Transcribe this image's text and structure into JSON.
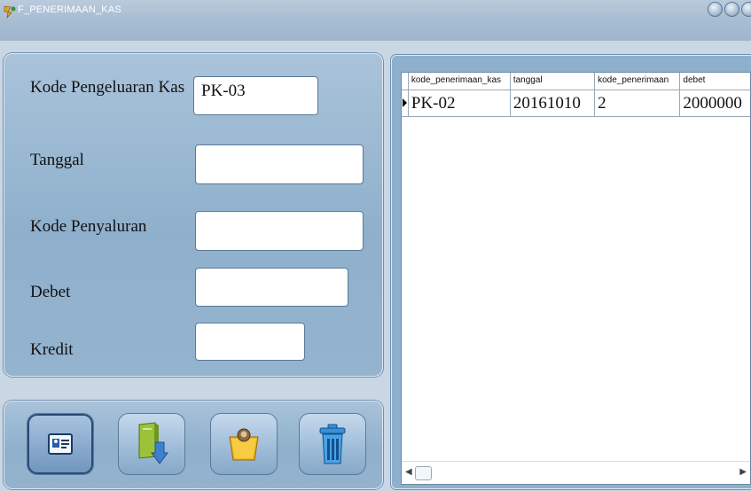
{
  "window": {
    "title": "F_PENERIMAAN_KAS"
  },
  "form": {
    "kode_label": "Kode Pengeluaran Kas",
    "kode_value": "PK-03",
    "tanggal_label": "Tanggal",
    "tanggal_value": "",
    "penyaluran_label": "Kode Penyaluran",
    "penyaluran_value": "",
    "debet_label": "Debet",
    "debet_value": "",
    "kredit_label": "Kredit",
    "kredit_value": ""
  },
  "toolbar": {
    "buttons": [
      "new-record-icon",
      "save-down-arrow-icon",
      "edit-folder-icon",
      "trash-icon"
    ]
  },
  "grid": {
    "headers": [
      "kode_penerimaan_kas",
      "tanggal",
      "kode_penerimaan",
      "debet"
    ],
    "rows": [
      [
        "PK-02",
        "20161010",
        "2",
        "2000000"
      ]
    ]
  }
}
